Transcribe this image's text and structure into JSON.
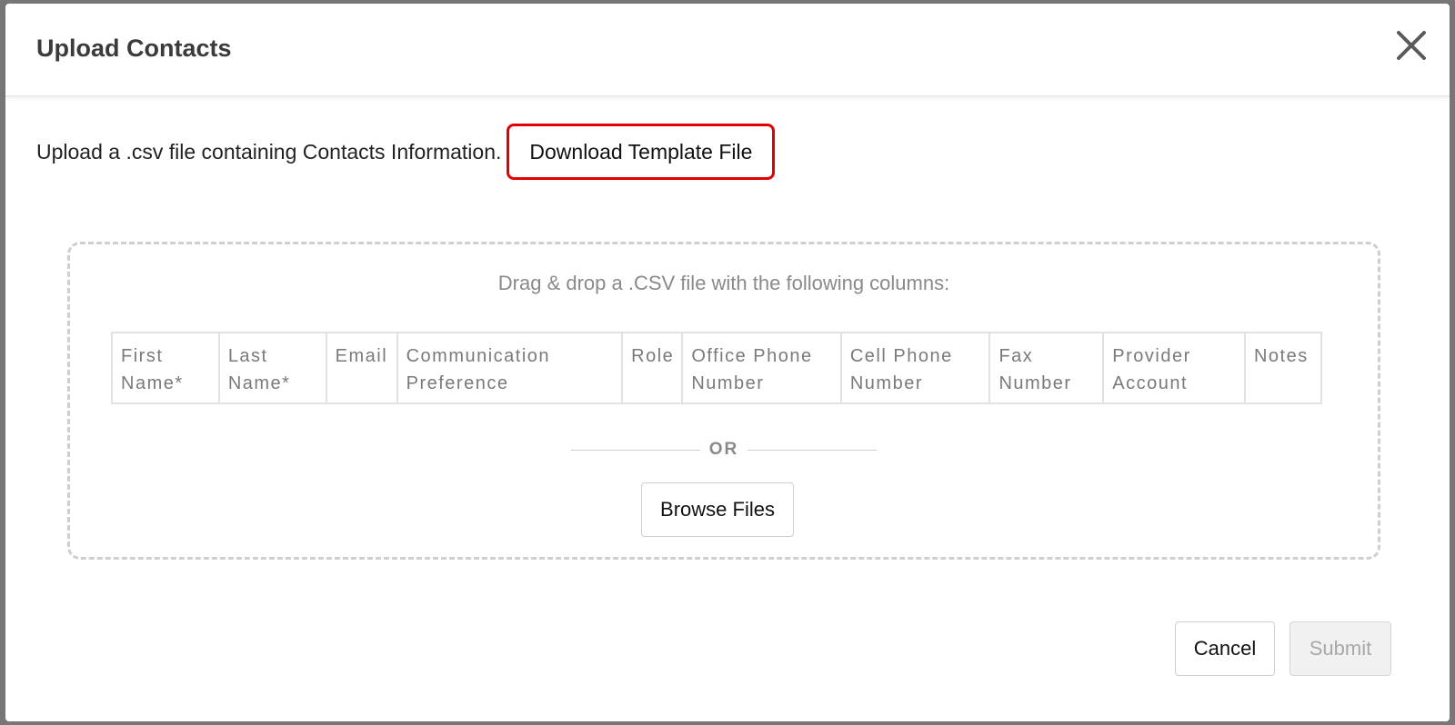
{
  "modal": {
    "title": "Upload Contacts",
    "close_icon": "close-icon"
  },
  "intro": {
    "text": "Upload a .csv file containing Contacts Information.",
    "download_label": "Download Template File",
    "highlight_color": "#e00000"
  },
  "dropzone": {
    "instruction": "Drag & drop a .CSV file with the following columns:",
    "columns": [
      "First Name*",
      "Last Name*",
      "Email",
      "Communication Preference",
      "Role",
      "Office Phone Number",
      "Cell Phone Number",
      "Fax Number",
      "Provider Account",
      "Notes"
    ],
    "or_label": "OR",
    "browse_label": "Browse Files"
  },
  "footer": {
    "cancel_label": "Cancel",
    "submit_label": "Submit",
    "submit_disabled": true
  }
}
